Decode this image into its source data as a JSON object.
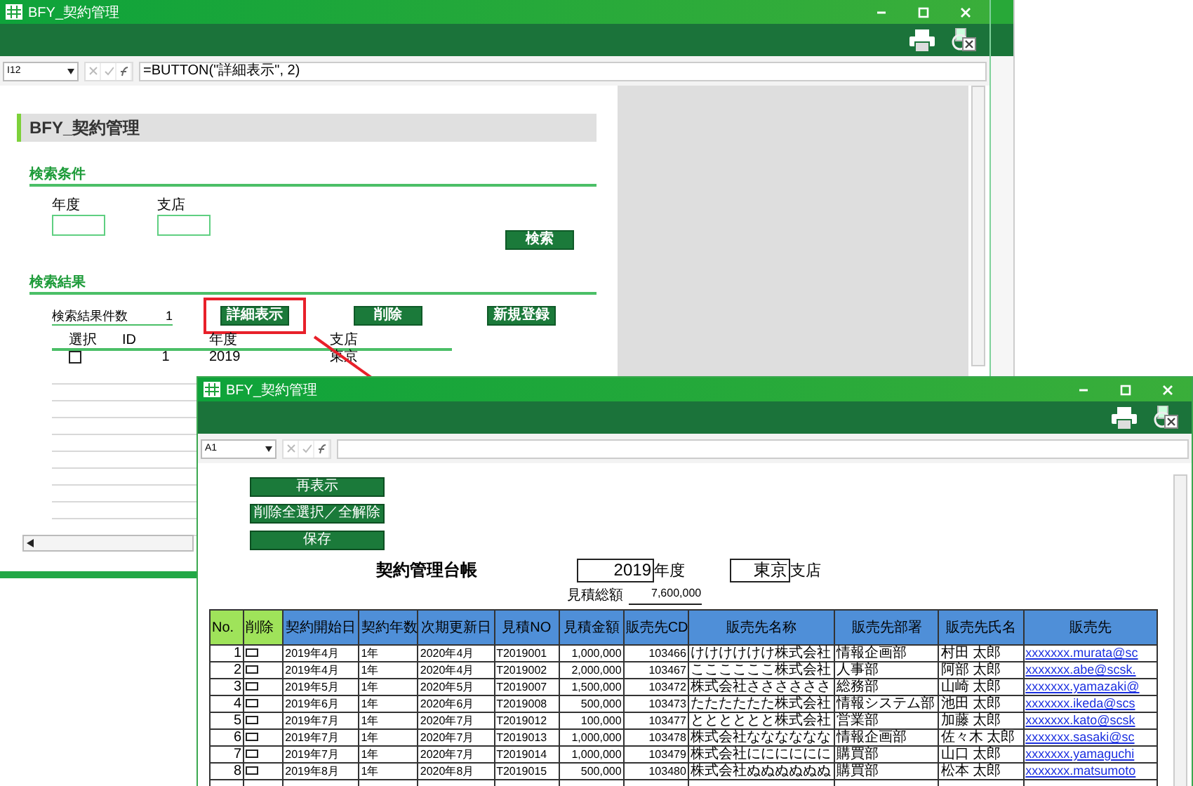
{
  "back_window": {
    "title": "BFY_契約管理",
    "cell_ref": "I12",
    "formula": "=BUTTON(\"詳細表示\", 2)",
    "page_title": "BFY_契約管理",
    "search_section": {
      "heading": "検索条件",
      "fields": [
        {
          "label": "年度"
        },
        {
          "label": "支店"
        }
      ],
      "search_button": "検索"
    },
    "results_section": {
      "heading": "検索結果",
      "count_label": "検索結果件数",
      "count": "1",
      "buttons": [
        {
          "label": "詳細表示",
          "highlighted": true
        },
        {
          "label": "削除",
          "highlighted": false
        },
        {
          "label": "新規登録",
          "highlighted": false
        }
      ],
      "columns": [
        "選択",
        "ID",
        "年度",
        "支店"
      ],
      "rows": [
        {
          "checked": false,
          "id": "1",
          "year": "2019",
          "branch": "東京"
        }
      ]
    }
  },
  "front_window": {
    "title": "BFY_契約管理",
    "cell_ref": "A1",
    "buttons": [
      "再表示",
      "削除全選択／全解除",
      "保存"
    ],
    "ledger_title": "契約管理台帳",
    "year": "2019",
    "year_label": "年度",
    "branch": "東京",
    "branch_label": "支店",
    "total_label": "見積総額",
    "total": "7,600,000",
    "table": {
      "key_columns": [
        "No.",
        "削除"
      ],
      "columns": [
        "契約開始日",
        "契約年数",
        "次期更新日",
        "見積NO",
        "見積金額",
        "販売先CD",
        "販売先名称",
        "販売先部署",
        "販売先氏名",
        "販売先"
      ],
      "rows": [
        {
          "no": "1",
          "delete_checked": false,
          "cells": [
            "2019年4月",
            "1年",
            "2020年4月",
            "T2019001",
            "1,000,000",
            "103466",
            "けけけけけけ株式会社",
            "情報企画部",
            "村田 太郎",
            "xxxxxxx.murata@sc"
          ]
        },
        {
          "no": "2",
          "delete_checked": false,
          "cells": [
            "2019年4月",
            "1年",
            "2020年4月",
            "T2019002",
            "2,000,000",
            "103467",
            "ここここここ株式会社",
            "人事部",
            "阿部 太郎",
            "xxxxxxx.abe@scsk."
          ]
        },
        {
          "no": "3",
          "delete_checked": false,
          "cells": [
            "2019年5月",
            "1年",
            "2020年5月",
            "T2019007",
            "1,500,000",
            "103472",
            "株式会社ささささささ",
            "総務部",
            "山崎 太郎",
            "xxxxxxx.yamazaki@"
          ]
        },
        {
          "no": "4",
          "delete_checked": false,
          "cells": [
            "2019年6月",
            "1年",
            "2020年6月",
            "T2019008",
            "500,000",
            "103473",
            "たたたたたた株式会社",
            "情報システム部",
            "池田 太郎",
            "xxxxxxx.ikeda@scs"
          ]
        },
        {
          "no": "5",
          "delete_checked": false,
          "cells": [
            "2019年7月",
            "1年",
            "2020年7月",
            "T2019012",
            "100,000",
            "103477",
            "とととととと株式会社",
            "営業部",
            "加藤 太郎",
            "xxxxxxx.kato@scsk"
          ]
        },
        {
          "no": "6",
          "delete_checked": false,
          "cells": [
            "2019年7月",
            "1年",
            "2020年7月",
            "T2019013",
            "1,000,000",
            "103478",
            "株式会社なななななな",
            "情報企画部",
            "佐々木 太郎",
            "xxxxxxx.sasaki@sc"
          ]
        },
        {
          "no": "7",
          "delete_checked": false,
          "cells": [
            "2019年7月",
            "1年",
            "2020年7月",
            "T2019014",
            "1,000,000",
            "103479",
            "株式会社にににににに",
            "購買部",
            "山口 太郎",
            "xxxxxxx.yamaguchi"
          ]
        },
        {
          "no": "8",
          "delete_checked": false,
          "cells": [
            "2019年8月",
            "1年",
            "2020年8月",
            "T2019015",
            "500,000",
            "103480",
            "株式会社ぬぬぬぬぬぬ",
            "購買部",
            "松本 太郎",
            "xxxxxxx.matsumoto"
          ]
        }
      ]
    }
  }
}
